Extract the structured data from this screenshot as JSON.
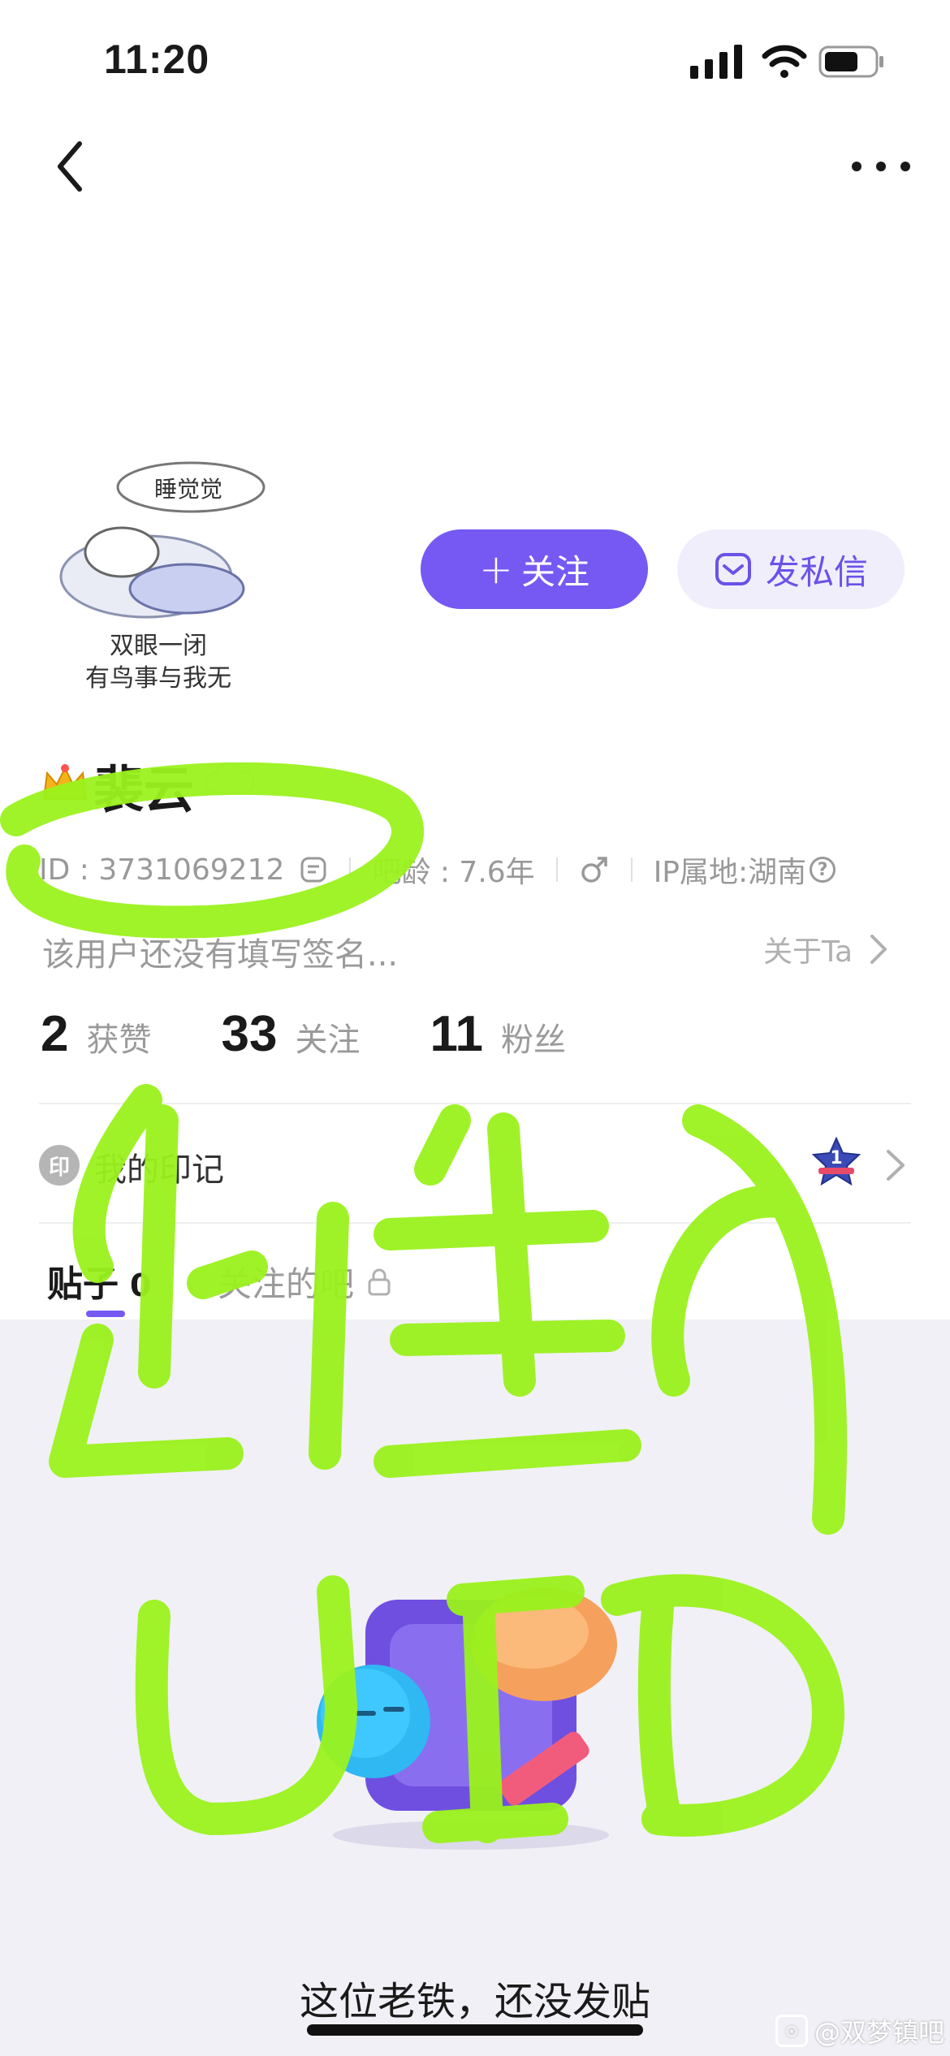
{
  "status_bar": {
    "time": "11:20"
  },
  "nav": {
    "back_icon": "chevron-left-icon",
    "more_icon": "more-horizontal-icon"
  },
  "profile": {
    "avatar_caption_top": "睡觉觉",
    "avatar_caption_line1": "双眼一闭",
    "avatar_caption_line2": "有鸟事与我无",
    "follow_label": "关注",
    "dm_label": "发私信",
    "username": "裴云",
    "id_text": "ID : 3731069212",
    "bar_age": "吧龄 : 7.6年",
    "gender_icon": "male-icon",
    "ip_location": "IP属地:湖南",
    "signature": "该用户还没有填写签名...",
    "about_label": "关于Ta"
  },
  "stats": [
    {
      "value": "2",
      "label": "获赞"
    },
    {
      "value": "33",
      "label": "关注"
    },
    {
      "value": "11",
      "label": "粉丝"
    }
  ],
  "badges": {
    "icon_text": "印",
    "label": "我的印记",
    "medal_number": "1"
  },
  "tabs": {
    "posts_label": "贴子",
    "posts_count": "0",
    "followed_bars_label": "关注的吧"
  },
  "empty_state": {
    "text": "这位老铁，还没发贴"
  },
  "watermark": {
    "text": "@双梦镇吧"
  },
  "colors": {
    "accent": "#7559f2",
    "dm_bg": "#f1eefc",
    "scribble": "#9af21c"
  }
}
